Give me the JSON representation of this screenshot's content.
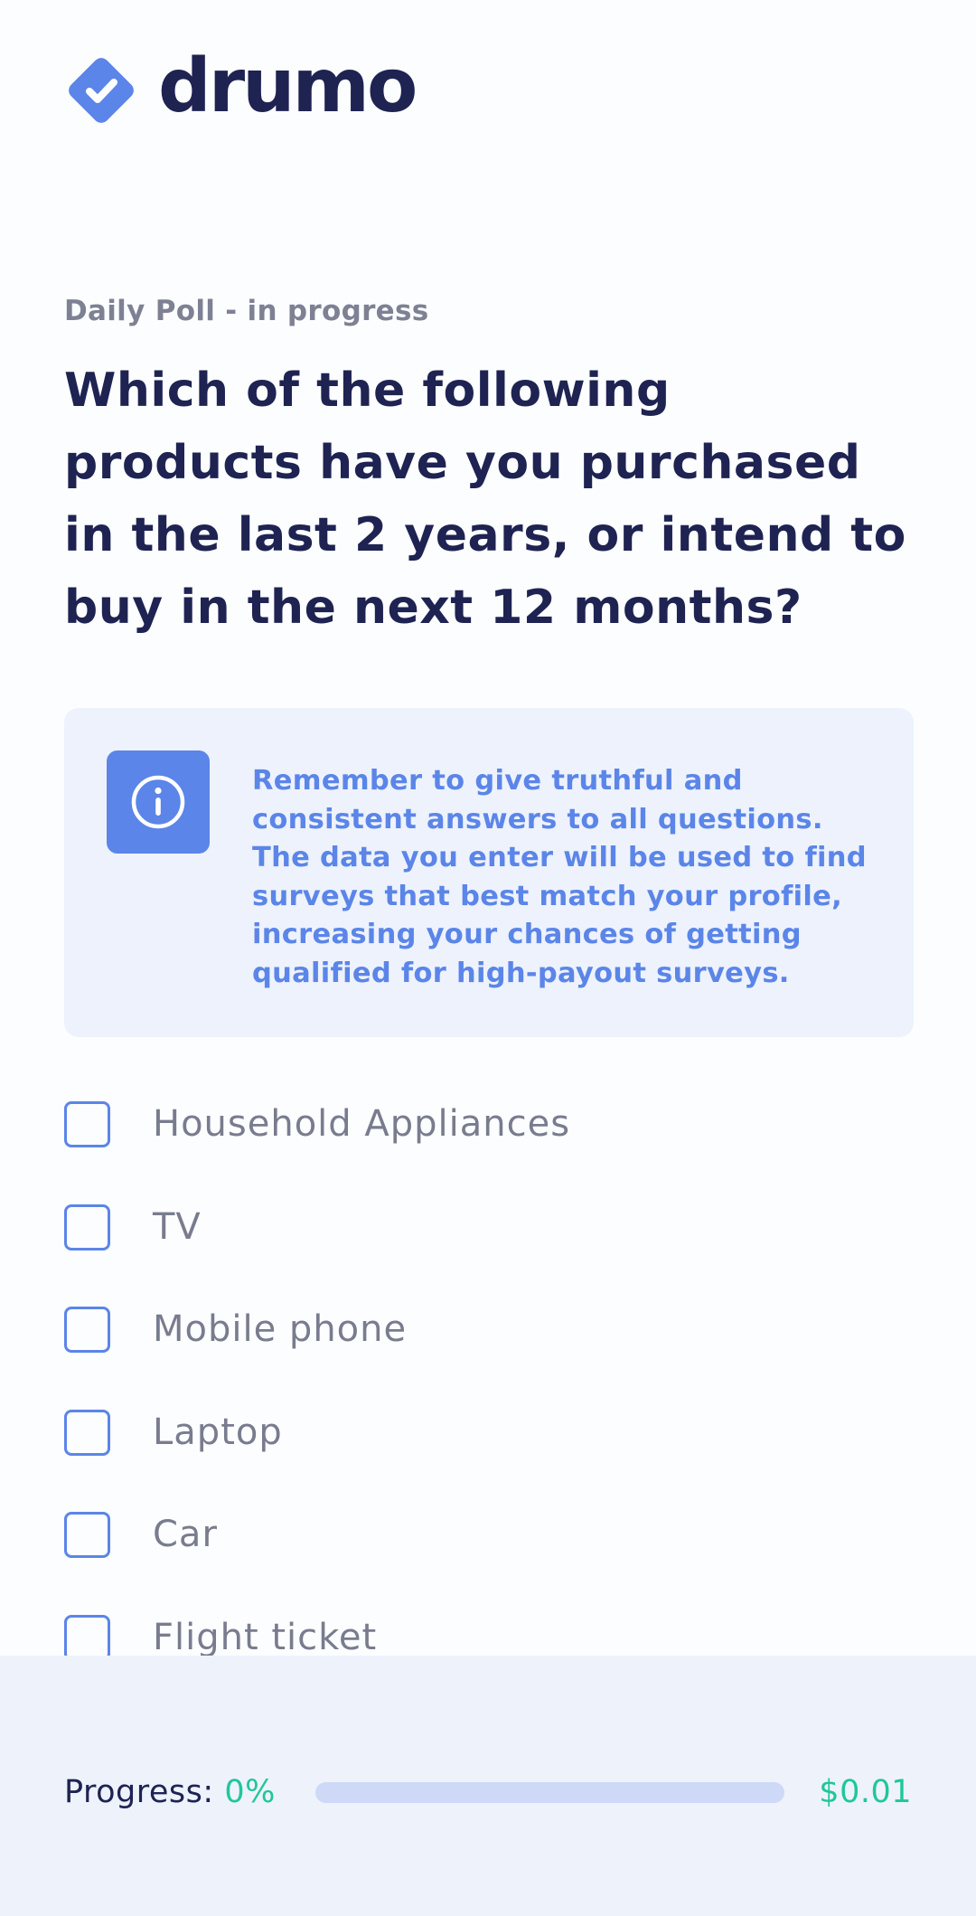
{
  "brand": {
    "name": "drumo",
    "logo_icon": "check-diamond-icon",
    "color": "#5b85e8",
    "text_color": "#1e2352"
  },
  "poll": {
    "status": "Daily Poll - in progress",
    "question": "Which of the following products have you purchased in the last 2 years, or intend to buy in the next 12 months?"
  },
  "notice": {
    "icon": "info-icon",
    "text": "Remember to give truthful and consistent answers to all questions. The data you enter will be used to find surveys that best match your profile, increasing your chances of getting qualified for high-payout surveys."
  },
  "options": [
    {
      "label": "Household Appliances",
      "checked": false
    },
    {
      "label": "TV",
      "checked": false
    },
    {
      "label": "Mobile phone",
      "checked": false
    },
    {
      "label": "Laptop",
      "checked": false
    },
    {
      "label": "Car",
      "checked": false
    },
    {
      "label": "Flight ticket",
      "checked": false
    }
  ],
  "footer": {
    "progress_label": "Progress:",
    "progress_percent": "0%",
    "progress_value": 0,
    "reward": "$0.01",
    "accent_color": "#1fc79a"
  }
}
